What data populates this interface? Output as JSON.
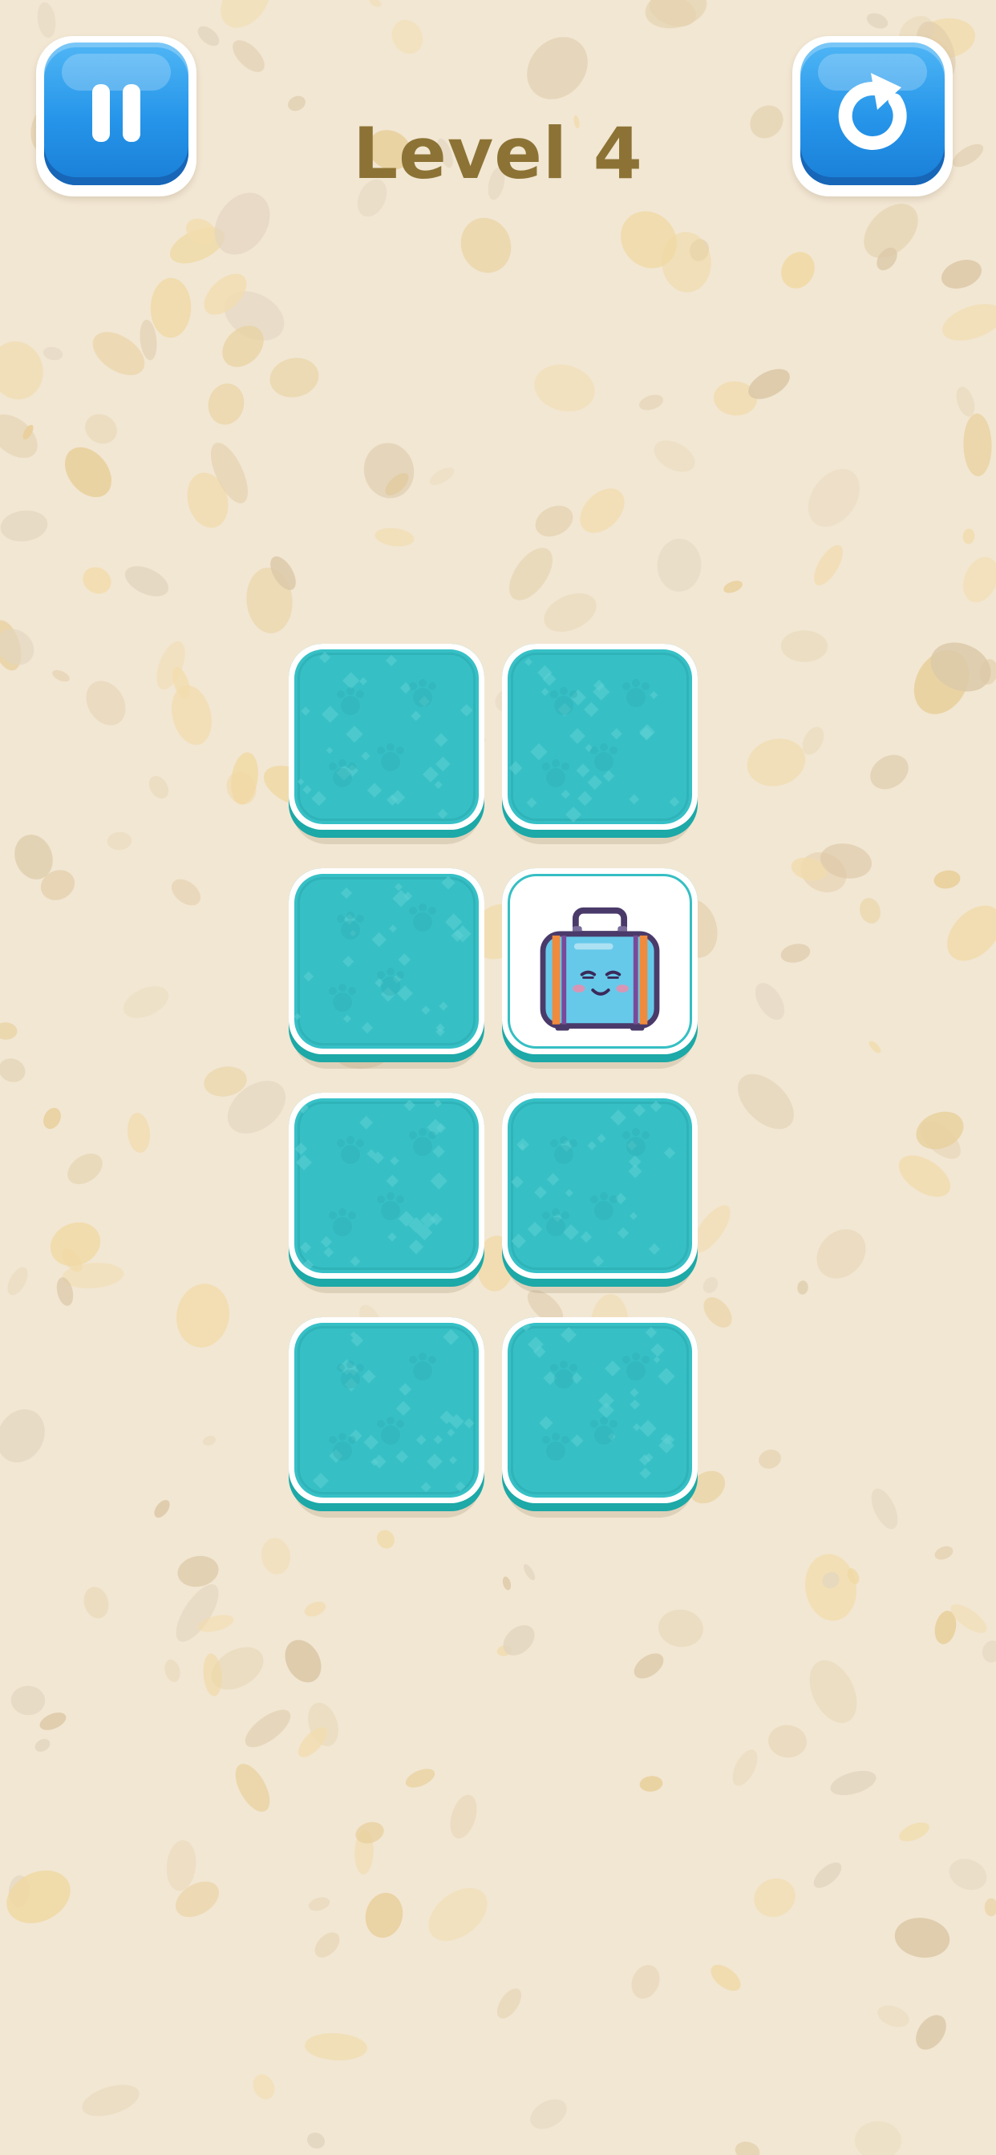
{
  "hud": {
    "title": "Level 4",
    "pause_icon": "pause-icon",
    "restart_icon": "restart-icon"
  },
  "colors": {
    "background": "#f2e7d3",
    "title": "#8c7335",
    "button_blue": "#2594e9",
    "card_back": "#36c0c6",
    "card_edge": "#1ca9a7"
  },
  "board": {
    "rows": 4,
    "columns": 2,
    "cards": [
      {
        "state": "face-down"
      },
      {
        "state": "face-down"
      },
      {
        "state": "face-down"
      },
      {
        "state": "face-up",
        "picture": "suitcase-icon"
      },
      {
        "state": "face-down"
      },
      {
        "state": "face-down"
      },
      {
        "state": "face-down"
      },
      {
        "state": "face-down"
      }
    ]
  }
}
